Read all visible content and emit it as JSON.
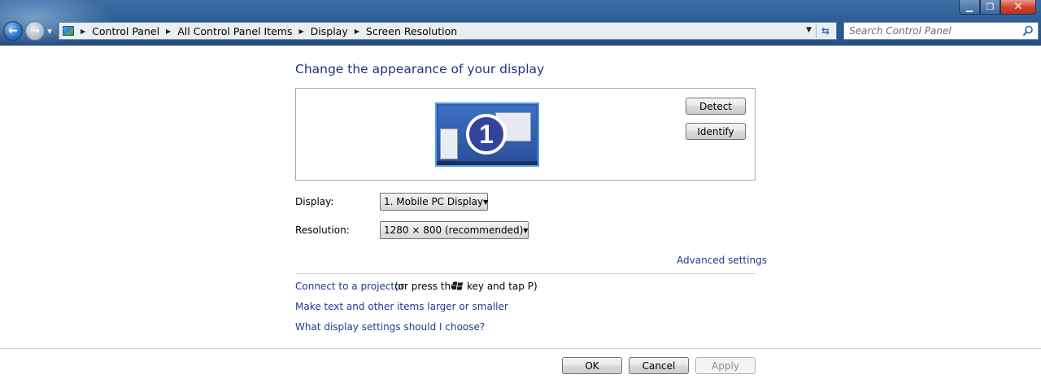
{
  "window": {
    "minimize_glyph": "▁",
    "maximize_glyph": "❐",
    "close_glyph": "✕"
  },
  "nav": {
    "back_glyph": "←",
    "forward_glyph": "→",
    "history_glyph": "▼",
    "breadcrumb": [
      "Control Panel",
      "All Control Panel Items",
      "Display",
      "Screen Resolution"
    ],
    "breadcrumb_arrow": "▶",
    "address_dropdown_glyph": "▼",
    "refresh_glyph": "⇆",
    "search_placeholder": "Search Control Panel"
  },
  "main": {
    "heading": "Change the appearance of your display",
    "monitor_number": "1",
    "detect_label": "Detect",
    "identify_label": "Identify",
    "display_label": "Display:",
    "display_value": "1. Mobile PC Display",
    "resolution_label": "Resolution:",
    "resolution_value": "1280 × 800 (recommended)",
    "combo_caret": "▼",
    "advanced_link": "Advanced settings",
    "projector_link": "Connect to a projector",
    "projector_text_before": "(or press the",
    "projector_text_after": "key and tap P)",
    "text_size_link": "Make text and other items larger or smaller",
    "help_link": "What display settings should I choose?"
  },
  "footer": {
    "ok_label": "OK",
    "cancel_label": "Cancel",
    "apply_label": "Apply"
  },
  "icons": {
    "address": "control-panel-icon",
    "search": "search-icon",
    "windows_key": "windows-logo-icon"
  },
  "colors": {
    "link": "#1e3c8f",
    "heading": "#1e3287",
    "titlebar": "#2f5f96"
  }
}
